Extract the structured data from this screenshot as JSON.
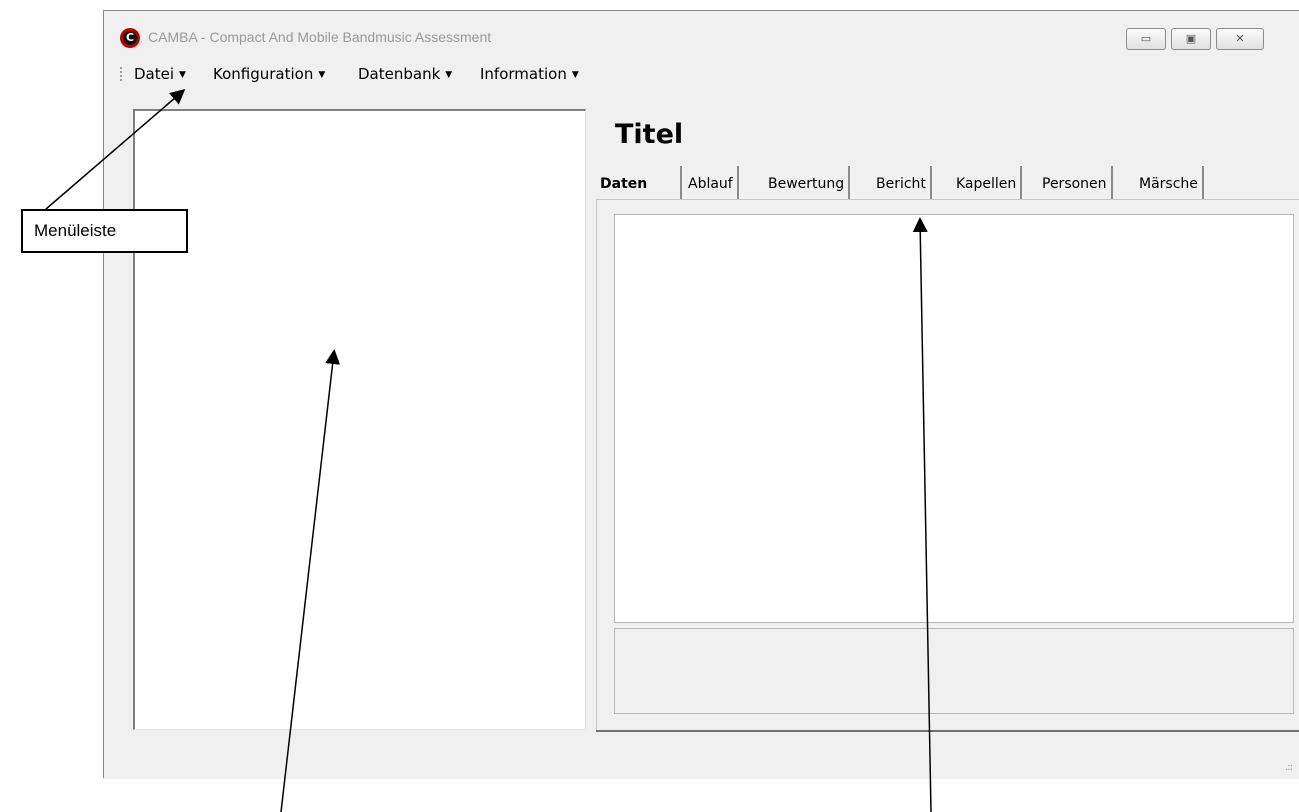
{
  "window": {
    "title": "CAMBA - Compact And Mobile Bandmusic Assessment",
    "app_icon_letter": "C",
    "buttons": {
      "minimize": "▭",
      "maximize": "▣",
      "close": "✕"
    }
  },
  "menubar": {
    "items": [
      {
        "label": "Datei"
      },
      {
        "label": "Konfiguration"
      },
      {
        "label": "Datenbank"
      },
      {
        "label": "Information"
      }
    ]
  },
  "main": {
    "title": "Titel",
    "tabs": [
      {
        "label": "Daten",
        "active": true
      },
      {
        "label": "Ablauf"
      },
      {
        "label": "Bewertung"
      },
      {
        "label": "Bericht"
      },
      {
        "label": "Kapellen"
      },
      {
        "label": "Personen"
      },
      {
        "label": "Märsche"
      }
    ]
  },
  "annotation": {
    "menubar_label": "Menüleiste"
  },
  "colors": {
    "window_bg": "#f0f0f0",
    "panel_bg": "#ffffff",
    "icon_red": "#c00000"
  }
}
